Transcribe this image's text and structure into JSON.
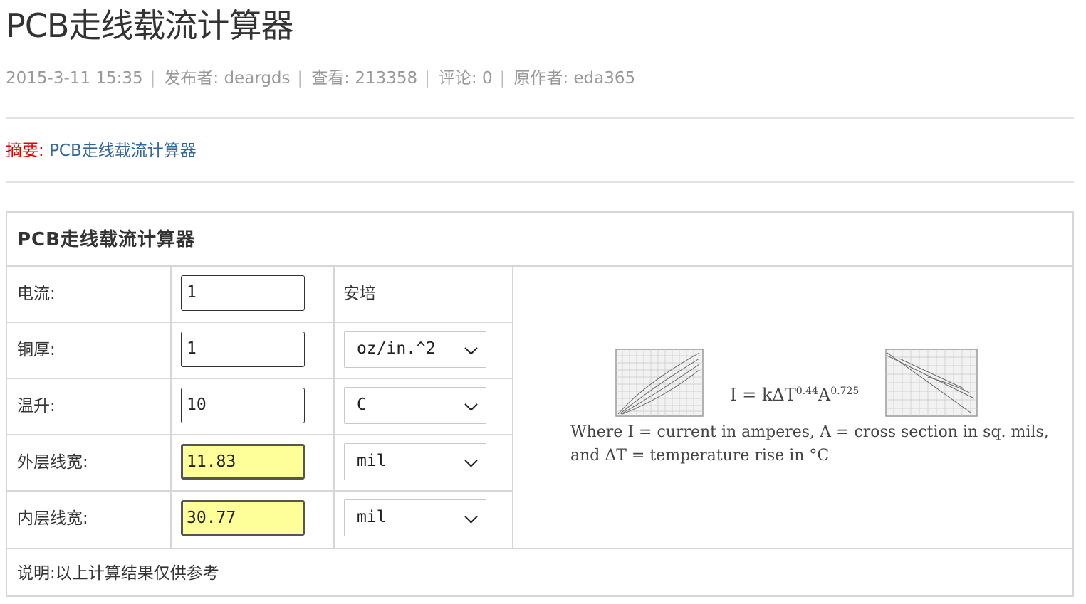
{
  "article": {
    "title": "PCB走线载流计算器",
    "meta": {
      "date": "2015-3-11 15:35",
      "publisher_label": "发布者:",
      "publisher": "deargds",
      "views_label": "查看:",
      "views": "213358",
      "comments_label": "评论:",
      "comments": "0",
      "author_label": "原作者:",
      "author": "eda365",
      "separator": "|"
    },
    "summary_label": "摘要:",
    "summary_text": "PCB走线载流计算器"
  },
  "calculator": {
    "title": "PCB走线载流计算器",
    "rows": [
      {
        "label": "电流:",
        "value": "1",
        "unit": "安培",
        "unit_type": "text"
      },
      {
        "label": "铜厚:",
        "value": "1",
        "unit": "oz/in.^2",
        "unit_type": "select"
      },
      {
        "label": "温升:",
        "value": "10",
        "unit": "C",
        "unit_type": "select"
      },
      {
        "label": "外层线宽:",
        "value": "11.83",
        "unit": "mil",
        "unit_type": "select",
        "result": true
      },
      {
        "label": "内层线宽:",
        "value": "30.77",
        "unit": "mil",
        "unit_type": "select",
        "result": true
      }
    ],
    "note": "说明:以上计算结果仅供参考",
    "formula": {
      "lhs": "I = kΔT",
      "exp1": "0.44",
      "mid": "A",
      "exp2": "0.725",
      "where_line1": "Where I = current in amperes, A = cross section in sq. mils,",
      "where_line2": "and ΔT = temperature rise in °C"
    }
  },
  "colors": {
    "summary_label": "#e00000",
    "summary_text": "#336699",
    "result_bg": "#ffff99",
    "meta_text": "#999999"
  }
}
